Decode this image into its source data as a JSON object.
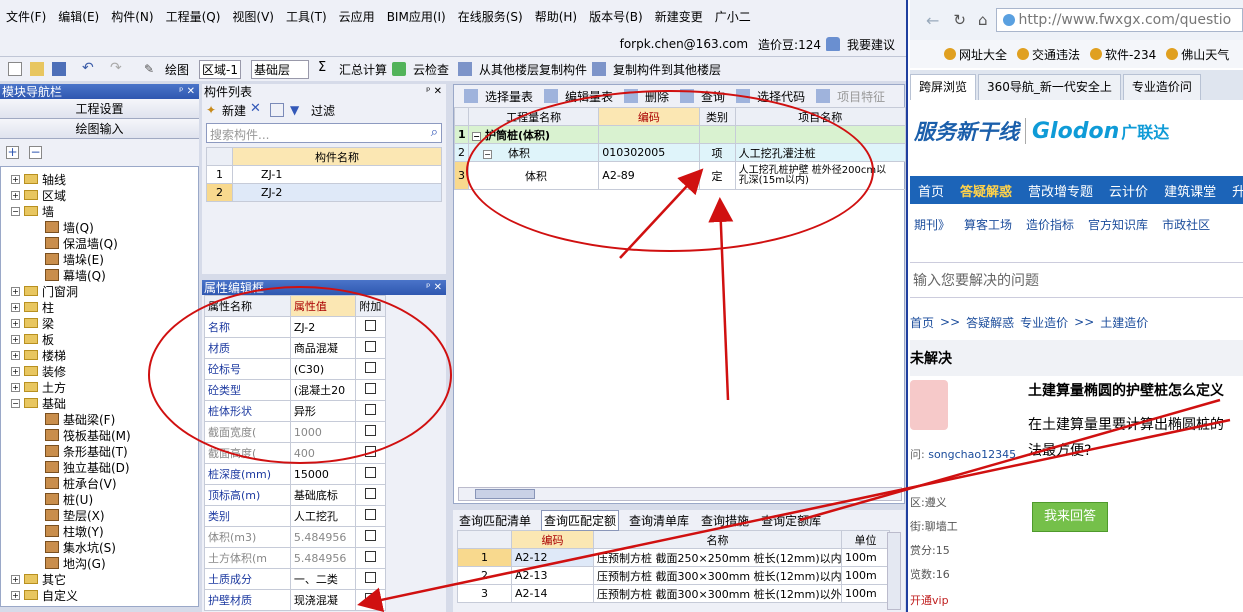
{
  "menu": [
    "文件(F)",
    "编辑(E)",
    "构件(N)",
    "工程量(Q)",
    "视图(V)",
    "工具(T)",
    "云应用",
    "BIM应用(I)",
    "在线服务(S)",
    "帮助(H)",
    "版本号(B)",
    "新建变更",
    "广小二"
  ],
  "account": {
    "email": "forpk.chen@163.com",
    "price_beans": "造价豆:124",
    "suggest": "我要建议"
  },
  "toolbar": {
    "draw": "绘图",
    "region": "区域-1",
    "floor": "基础层",
    "sum": "汇总计算",
    "cloud_check": "云检查",
    "copy_from": "从其他楼层复制构件",
    "copy_to": "复制构件到其他楼层"
  },
  "nav": {
    "title": "模块导航栏",
    "btn_settings": "工程设置",
    "btn_draw": "绘图输入",
    "tree": [
      {
        "label": "轴线",
        "level": 0,
        "exp": "+"
      },
      {
        "label": "区域",
        "level": 0,
        "exp": "+"
      },
      {
        "label": "墙",
        "level": 0,
        "exp": "-"
      },
      {
        "label": "墙(Q)",
        "level": 1
      },
      {
        "label": "保温墙(Q)",
        "level": 1
      },
      {
        "label": "墙垛(E)",
        "level": 1
      },
      {
        "label": "幕墙(Q)",
        "level": 1
      },
      {
        "label": "门窗洞",
        "level": 0,
        "exp": "+"
      },
      {
        "label": "柱",
        "level": 0,
        "exp": "+"
      },
      {
        "label": "梁",
        "level": 0,
        "exp": "+"
      },
      {
        "label": "板",
        "level": 0,
        "exp": "+"
      },
      {
        "label": "楼梯",
        "level": 0,
        "exp": "+"
      },
      {
        "label": "装修",
        "level": 0,
        "exp": "+"
      },
      {
        "label": "土方",
        "level": 0,
        "exp": "+"
      },
      {
        "label": "基础",
        "level": 0,
        "exp": "-"
      },
      {
        "label": "基础梁(F)",
        "level": 1
      },
      {
        "label": "筏板基础(M)",
        "level": 1
      },
      {
        "label": "条形基础(T)",
        "level": 1
      },
      {
        "label": "独立基础(D)",
        "level": 1
      },
      {
        "label": "桩承台(V)",
        "level": 1
      },
      {
        "label": "桩(U)",
        "level": 1
      },
      {
        "label": "垫层(X)",
        "level": 1
      },
      {
        "label": "柱墩(Y)",
        "level": 1
      },
      {
        "label": "集水坑(S)",
        "level": 1
      },
      {
        "label": "地沟(G)",
        "level": 1
      },
      {
        "label": "其它",
        "level": 0,
        "exp": "+"
      },
      {
        "label": "自定义",
        "level": 0,
        "exp": "+"
      }
    ]
  },
  "comp": {
    "title": "构件列表",
    "new": "新建",
    "filter": "过滤",
    "search_placeholder": "搜索构件...",
    "col": "构件名称",
    "rows": [
      {
        "n": "1",
        "name": "ZJ-1"
      },
      {
        "n": "2",
        "name": "ZJ-2"
      }
    ]
  },
  "props": {
    "title": "属性编辑框",
    "cols": [
      "属性名称",
      "属性值",
      "附加"
    ],
    "rows": [
      {
        "name": "名称",
        "value": "ZJ-2",
        "grey": false
      },
      {
        "name": "材质",
        "value": "商品混凝",
        "grey": false
      },
      {
        "name": "砼标号",
        "value": "(C30)",
        "grey": false
      },
      {
        "name": "砼类型",
        "value": "(混凝土20",
        "grey": false
      },
      {
        "name": "桩体形状",
        "value": "异形",
        "grey": false
      },
      {
        "name": "截面宽度(",
        "value": "1000",
        "grey": true
      },
      {
        "name": "截面高度(",
        "value": "400",
        "grey": true
      },
      {
        "name": "桩深度(mm)",
        "value": "15000",
        "grey": false
      },
      {
        "name": "顶标高(m)",
        "value": "基础底标",
        "grey": false
      },
      {
        "name": "类别",
        "value": "人工挖孔",
        "grey": false
      },
      {
        "name": "体积(m3)",
        "value": "5.484956",
        "grey": true
      },
      {
        "name": "土方体积(m",
        "value": "5.484956",
        "grey": true
      },
      {
        "name": "土质成分",
        "value": "一、二类",
        "grey": false
      },
      {
        "name": "护壁材质",
        "value": "现浇混凝",
        "grey": false
      }
    ]
  },
  "qty": {
    "toolbar": [
      "选择量表",
      "编辑量表",
      "删除",
      "查询",
      "选择代码",
      "项目特征"
    ],
    "cols": [
      "工程量名称",
      "编码",
      "类别",
      "项目名称"
    ],
    "rows": [
      {
        "n": "1",
        "name": "护筒桩(体积)",
        "code": "",
        "type": "",
        "proj": ""
      },
      {
        "n": "2",
        "name": "体积",
        "code": "010302005",
        "type": "项",
        "proj": "人工挖孔灌注桩"
      },
      {
        "n": "3",
        "name": "体积",
        "code": "A2-89",
        "type": "定",
        "proj": "人工挖孔桩护壁 桩外径200cm以",
        "proj2": "孔深(15m以内)"
      }
    ]
  },
  "match": {
    "tabs": [
      "查询匹配清单",
      "查询匹配定额",
      "查询清单库",
      "查询措施",
      "查询定额库"
    ],
    "cols": [
      "编码",
      "名称",
      "单位"
    ],
    "rows": [
      {
        "n": "1",
        "code": "A2-12",
        "name": "压预制方桩 截面250×250mm 桩长(12mm)以内",
        "unit": "100m"
      },
      {
        "n": "2",
        "code": "A2-13",
        "name": "压预制方桩 截面300×300mm 桩长(12mm)以内",
        "unit": "100m"
      },
      {
        "n": "3",
        "code": "A2-14",
        "name": "压预制方桩 截面300×300mm 桩长(12mm)以外",
        "unit": "100m"
      }
    ]
  },
  "browser": {
    "url": "http://www.fwxgx.com/questio",
    "bookmarks": [
      "网址大全",
      "交通违法",
      "软件-234",
      "佛山天气"
    ],
    "tabs": [
      "跨屏浏览",
      "360导航_新一代安全上",
      "专业造价问"
    ],
    "logo1": "服务新干线",
    "logo2": "Glodon",
    "logo3": "广联达",
    "nav": [
      "首页",
      "答疑解惑",
      "营改增专题",
      "云计价",
      "建筑课堂",
      "升级"
    ],
    "subnav": [
      "期刊》",
      "算客工场",
      "造价指标",
      "官方知识库",
      "市政社区"
    ],
    "ask_placeholder": "输入您要解决的问题",
    "crumb": [
      "首页",
      ">>",
      "答疑解惑",
      "专业造价",
      ">>",
      "土建造价"
    ],
    "status": "未解决",
    "q_title": "土建算量椭圆的护壁桩怎么定义",
    "q_body1": "在土建算量里要计算出椭圆桩的",
    "q_body2": "法最方便?",
    "asker_label": "问:",
    "asker": "songchao12345",
    "region": "区:遵义",
    "street": "街:聊墙工",
    "reward": "赏分:15",
    "views": "览数:16",
    "vip": "开通vip",
    "answer_btn": "我来回答"
  },
  "colors": {
    "annotation": "#d01010",
    "header_blue": "#2f57b0",
    "selected_row": "#dfe9f8",
    "green_row": "#d9f2d0"
  }
}
